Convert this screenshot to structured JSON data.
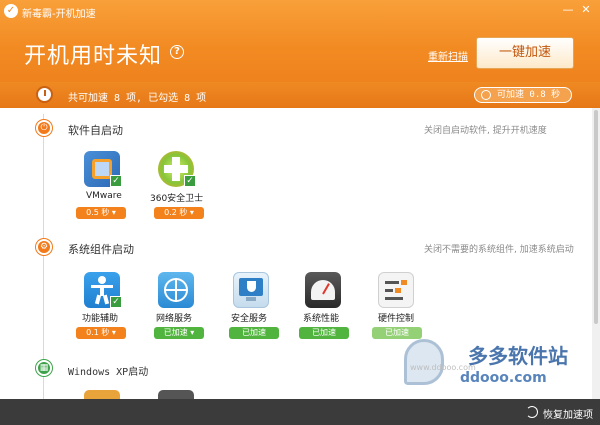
{
  "window": {
    "title": "新毒霸-开机加速",
    "minimize_glyph": "—",
    "close_glyph": "✕"
  },
  "header": {
    "headline": "开机用时未知",
    "help_glyph": "?",
    "rescan_label": "重新扫描",
    "one_key_label": "一键加速"
  },
  "summary": {
    "text": "共可加速 8 项, 已勾选 8 项",
    "speedup": "可加速 0.8 秒"
  },
  "sections": [
    {
      "title": "软件自启动",
      "hint": "关闭自启动软件, 提升开机速度",
      "icon": "startup-icon"
    },
    {
      "title": "系统组件启动",
      "hint": "关闭不需要的系统组件, 加速系统启动",
      "icon": "system-icon"
    },
    {
      "title": "Windows XP启动",
      "hint": "",
      "icon": "windows-icon"
    }
  ],
  "software_items": [
    {
      "name": "VMware",
      "badge": "0.5 秒 ▾",
      "checked": true,
      "icon": "vmware-icon"
    },
    {
      "name": "360安全卫士",
      "badge": "0.2 秒 ▾",
      "checked": true,
      "icon": "360-icon"
    }
  ],
  "system_items": [
    {
      "name": "功能辅助",
      "badge": "0.1 秒 ▾",
      "checked": true,
      "icon": "accessibility-icon"
    },
    {
      "name": "网络服务",
      "badge": "已加速 ▾",
      "checked": false,
      "icon": "network-icon"
    },
    {
      "name": "安全服务",
      "badge": "已加速",
      "checked": false,
      "icon": "security-icon"
    },
    {
      "name": "系统性能",
      "badge": "已加速",
      "checked": false,
      "icon": "performance-icon"
    },
    {
      "name": "硬件控制",
      "badge": "已加速",
      "checked": false,
      "icon": "hardware-icon"
    }
  ],
  "watermark": {
    "cn": "多多软件站",
    "en": "ddooo.com",
    "gray": "www.ddooo.com"
  },
  "footer": {
    "restore_label": "恢复加速项"
  },
  "colors": {
    "accent": "#f28a22",
    "green": "#51b43e",
    "footer": "#3b3b3b"
  }
}
